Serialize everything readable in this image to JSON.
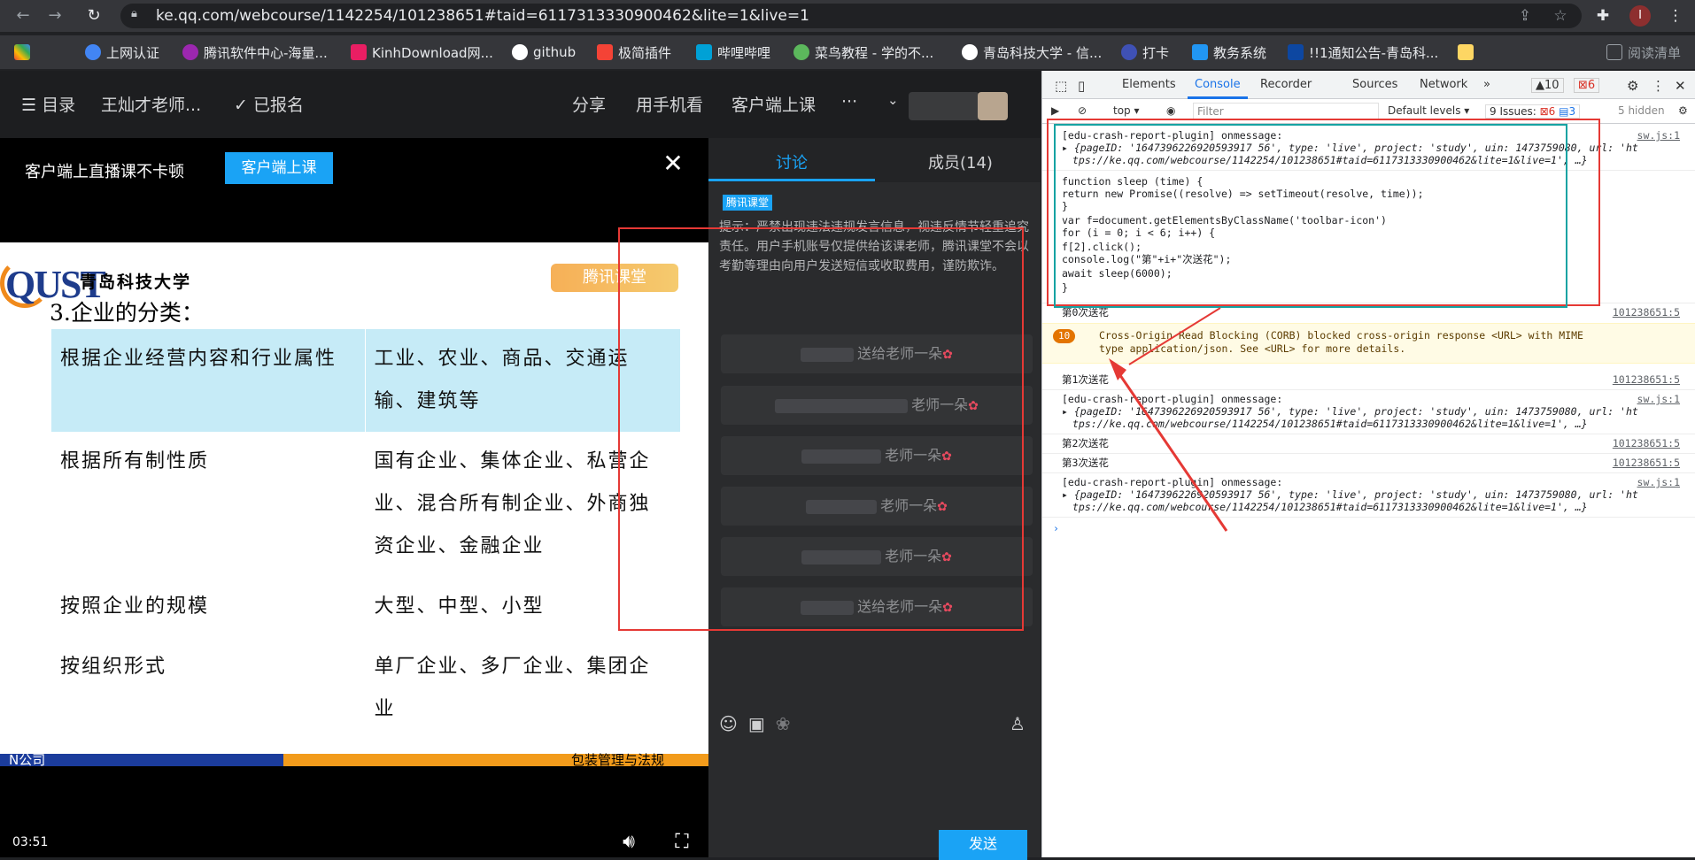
{
  "browser": {
    "url": "ke.qq.com/webcourse/1142254/101238651#taid=6117313330900462&lite=1&live=1",
    "profile_initial": "I"
  },
  "bookmarks": [
    {
      "label": "上网认证",
      "color": "#4285f4"
    },
    {
      "label": "腾讯软件中心-海量...",
      "color": "#9c27b0"
    },
    {
      "label": "KinhDownload网...",
      "color": "#e91e63"
    },
    {
      "label": "github",
      "color": "#333333"
    },
    {
      "label": "极简插件",
      "color": "#f44336"
    },
    {
      "label": "哔哩哔哩",
      "color": "#00a1d6"
    },
    {
      "label": "菜鸟教程 - 学的不...",
      "color": "#5cb85c"
    },
    {
      "label": "青岛科技大学 - 信...",
      "color": "#1565c0"
    },
    {
      "label": "打卡",
      "color": "#3f51b5"
    },
    {
      "label": "教务系统",
      "color": "#2196f3"
    },
    {
      "label": "!!1通知公告-青岛科...",
      "color": "#0d47a1"
    },
    {
      "label": "阅读清单",
      "color": "#9aa0a6"
    }
  ],
  "topbar": {
    "menu": "☰ 目录",
    "teacher": "王灿才老师...",
    "enrolled": "✓ 已报名",
    "share": "分享",
    "phone": "用手机看",
    "client": "客户端上课",
    "more": "···"
  },
  "banner": {
    "text": "客户端上直播课不卡顿",
    "button": "客户端上课"
  },
  "slide": {
    "university": "青岛科技大学",
    "logo_text": "QUST",
    "watermark": "腾讯课堂",
    "title": "3.企业的分类：",
    "rows": [
      {
        "criterion": "根据企业经营内容和行业属性",
        "types": "工业、农业、商品、交通运输、建筑等"
      },
      {
        "criterion": "根据所有制性质",
        "types": "国有企业、集体企业、私营企业、混合所有制企业、外商独资企业、金融企业"
      },
      {
        "criterion": "按照企业的规模",
        "types": "大型、中型、小型"
      },
      {
        "criterion": "按组织形式",
        "types": "单厂企业、多厂企业、集团企业"
      }
    ],
    "footer_left": "N公司",
    "footer_right": "包装管理与法规"
  },
  "video": {
    "time": "03:51"
  },
  "chat": {
    "tab_discuss": "讨论",
    "tab_members": "成员(14)",
    "badge": "腾讯课堂",
    "notice": "提示：严禁出现违法违规发言信息，视违反情节轻重追究责任。用户手机账号仅提供给该课老师，腾讯课堂不会以考勤等理由向用户发送短信或收取费用，谨防欺诈。",
    "messages": [
      "送给老师一朵",
      "老师一朵",
      "老师一朵",
      "老师一朵",
      "老师一朵",
      "送给老师一朵"
    ],
    "send": "发送"
  },
  "devtools": {
    "tabs": [
      "Elements",
      "Console",
      "Recorder",
      "Sources",
      "Network"
    ],
    "warn_count": "10",
    "err_count": "6",
    "context": "top",
    "filter_placeholder": "Filter",
    "levels": "Default levels",
    "issues": "9 Issues:",
    "issues_err": "6",
    "issues_info": "3",
    "hidden": "5 hidden",
    "plugin_msg": "[edu-crash-report-plugin] onmessage:",
    "plugin_obj": "{pageID: '1647396226920593917 56', type: 'live', project: 'study', uin: 1473759080, url: 'ht",
    "plugin_obj2": "tps://ke.qq.com/webcourse/1142254/101238651#taid=6117313330900462&lite=1&live=1', …}",
    "src_sw": "sw.js:1",
    "code": [
      "function sleep (time) {",
      "  return new Promise((resolve) => setTimeout(resolve, time));",
      "}",
      "var f=document.getElementsByClassName('toolbar-icon')",
      "for (i = 0; i < 6; i++) {",
      "    f[2].click();",
      "    console.log(\"第\"+i+\"次送花\");",
      "    await sleep(6000);",
      "}"
    ],
    "log0": "第0次送花",
    "log1": "第1次送花",
    "log2": "第2次送花",
    "log3": "第3次送花",
    "src_page": "101238651:5",
    "corb_count": "10",
    "corb": "Cross-Origin Read Blocking (CORB) blocked cross-origin response <URL> with MIME type application/json. See <URL> for more details."
  }
}
